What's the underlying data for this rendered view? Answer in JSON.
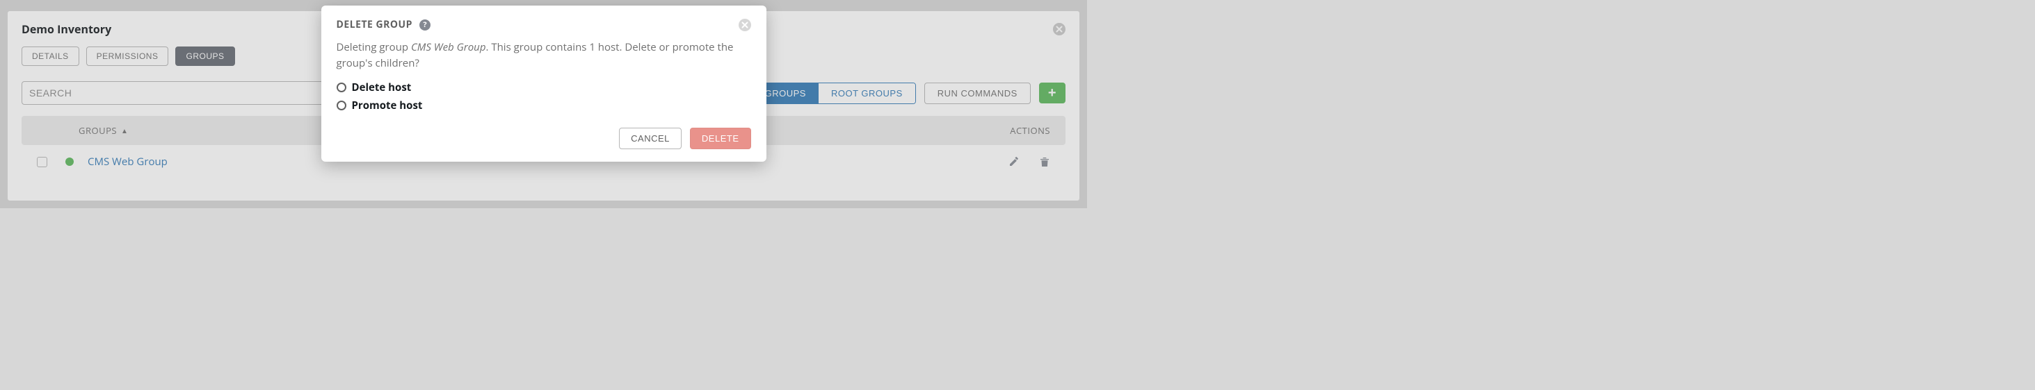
{
  "panel": {
    "title": "Demo Inventory"
  },
  "tabs": {
    "details": "DETAILS",
    "permissions": "PERMISSIONS",
    "groups": "GROUPS"
  },
  "search": {
    "placeholder": "SEARCH"
  },
  "seg": {
    "all": "ALL GROUPS",
    "root": "ROOT GROUPS"
  },
  "toolbar": {
    "run": "RUN COMMANDS",
    "plus": "+"
  },
  "table": {
    "header_groups": "GROUPS",
    "header_actions": "ACTIONS",
    "rows": [
      {
        "name": "CMS Web Group"
      }
    ]
  },
  "modal": {
    "title": "DELETE GROUP",
    "help_glyph": "?",
    "body_p1a": "Deleting group ",
    "body_p1b": "CMS Web Group",
    "body_p1c": ". This group contains 1 host. Delete or promote the group's children?",
    "option_delete": "Delete host",
    "option_promote": "Promote host",
    "cancel": "CANCEL",
    "delete": "DELETE"
  }
}
